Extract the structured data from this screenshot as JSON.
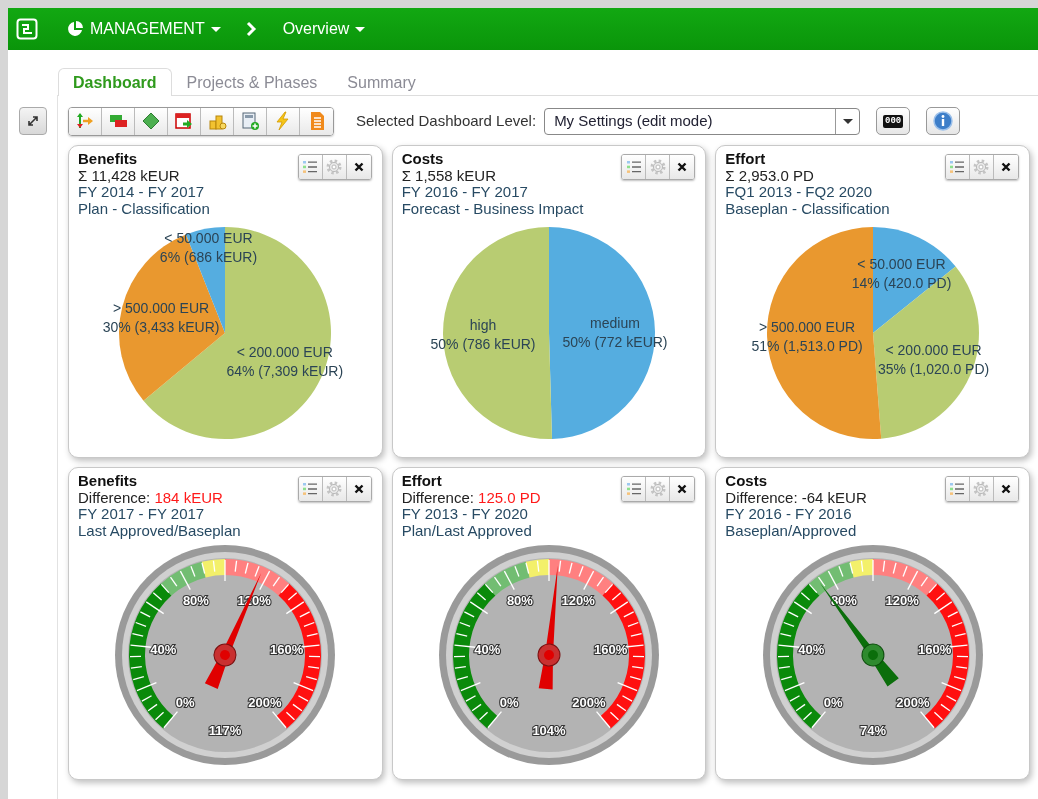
{
  "app_bar": {
    "module": "MANAGEMENT",
    "page": "Overview"
  },
  "tabs": [
    {
      "label": "Dashboard",
      "selected": true
    },
    {
      "label": "Projects & Phases",
      "selected": false
    },
    {
      "label": "Summary",
      "selected": false
    }
  ],
  "toolbar": {
    "level_label": "Selected Dashboard Level:",
    "level_value": "My Settings (edit mode)",
    "counter": "000"
  },
  "widgets": [
    {
      "kind": "pie",
      "title": "Benefits",
      "total": "Σ 11,428 kEUR",
      "period": "FY 2014 - FY 2017",
      "basis": "Plan - Classification",
      "chart_data": {
        "type": "pie",
        "categories": [
          "< 200.000 EUR",
          "> 500.000 EUR",
          "< 50.000 EUR"
        ],
        "values": [
          7309,
          3433,
          686
        ],
        "colors": [
          "#b8cc72",
          "#e9982f",
          "#55ade0"
        ],
        "value_labels": [
          "64% (7,309 kEUR)",
          "30% (3,433 kEUR)",
          "6% (686 kEUR)"
        ]
      }
    },
    {
      "kind": "pie",
      "title": "Costs",
      "total": "Σ 1,558 kEUR",
      "period": "FY 2016 - FY 2017",
      "basis": "Forecast - Business Impact",
      "chart_data": {
        "type": "pie",
        "categories": [
          "medium",
          "high"
        ],
        "values": [
          772,
          786
        ],
        "colors": [
          "#55ade0",
          "#b8cc72"
        ],
        "value_labels": [
          "50% (772 kEUR)",
          "50% (786 kEUR)"
        ]
      }
    },
    {
      "kind": "pie",
      "title": "Effort",
      "total": "Σ 2,953.0 PD",
      "period": "FQ1 2013 - FQ2 2020",
      "basis": "Baseplan - Classification",
      "chart_data": {
        "type": "pie",
        "categories": [
          "< 50.000 EUR",
          "< 200.000 EUR",
          "> 500.000 EUR"
        ],
        "values": [
          420,
          1020,
          1513
        ],
        "colors": [
          "#55ade0",
          "#b8cc72",
          "#e9982f"
        ],
        "value_labels": [
          "14% (420.0 PD)",
          "35% (1,020.0 PD)",
          "51% (1,513.0 PD)"
        ]
      }
    },
    {
      "kind": "gauge",
      "title": "Benefits",
      "difference_label": "Difference:",
      "difference": "184 kEUR",
      "alert": true,
      "period": "FY 2017 - FY 2017",
      "basis": "Last Approved/Baseplan",
      "tick_labels": [
        "0%",
        "40%",
        "80%",
        "120%",
        "160%",
        "200%"
      ],
      "level": 0.585,
      "reading": "117%"
    },
    {
      "kind": "gauge",
      "title": "Effort",
      "difference_label": "Difference:",
      "difference": "125.0 PD",
      "alert": true,
      "period": "FY 2013 - FY 2020",
      "basis": "Plan/Last Approved",
      "tick_labels": [
        "0%",
        "40%",
        "80%",
        "120%",
        "160%",
        "200%"
      ],
      "level": 0.52,
      "reading": "104%"
    },
    {
      "kind": "gauge",
      "title": "Costs",
      "difference_label": "Difference:",
      "difference": "-64 kEUR",
      "alert": false,
      "period": "FY 2016 - FY 2016",
      "basis": "Baseplan/Approved",
      "tick_labels": [
        "0%",
        "40%",
        "80%",
        "120%",
        "160%",
        "200%"
      ],
      "level": 0.37,
      "reading": "74%"
    }
  ]
}
